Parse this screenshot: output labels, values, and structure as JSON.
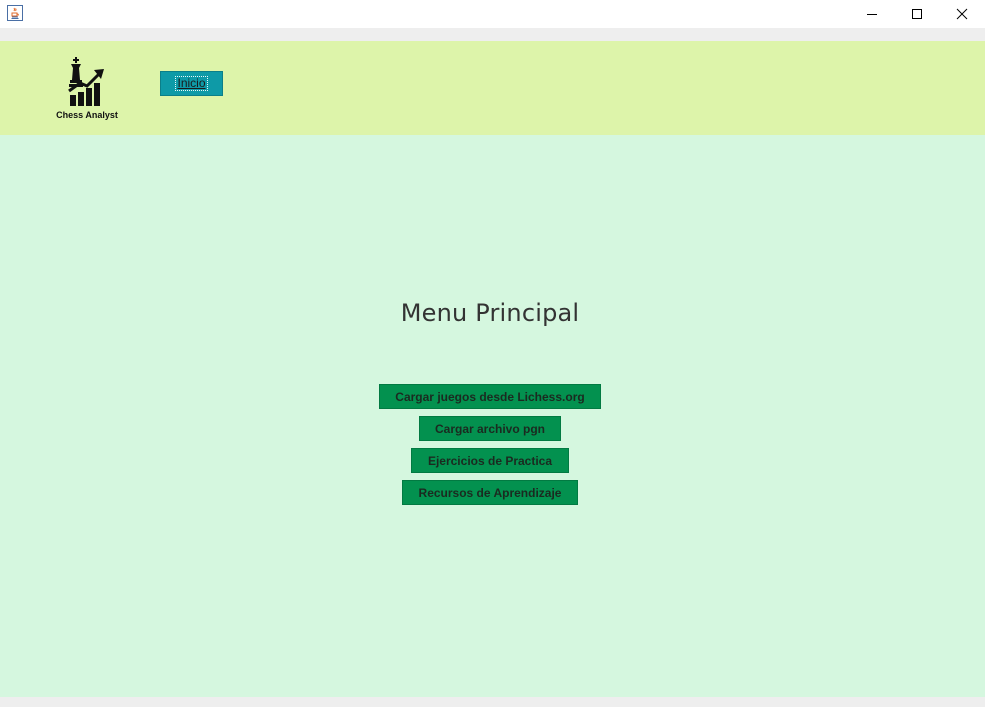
{
  "window": {
    "app_icon": "java-coffee-icon",
    "controls": {
      "minimize_icon": "minimize-icon",
      "maximize_icon": "maximize-icon",
      "close_icon": "close-icon"
    }
  },
  "header": {
    "logo": {
      "icon": "chess-king-growth-chart-icon",
      "caption": "Chess Analyst"
    },
    "nav": {
      "inicio_label": "Inicio"
    },
    "background_color": "#ddf4aa"
  },
  "main": {
    "title": "Menu Principal",
    "background_color": "#d5f7df",
    "buttons": [
      {
        "label": "Cargar juegos desde Lichess.org"
      },
      {
        "label": "Cargar archivo pgn"
      },
      {
        "label": "Ejercicios de Practica"
      },
      {
        "label": "Recursos de Aprendizaje"
      }
    ],
    "button_color": "#03914f"
  },
  "colors": {
    "inicio_button": "#0e9aa7"
  }
}
